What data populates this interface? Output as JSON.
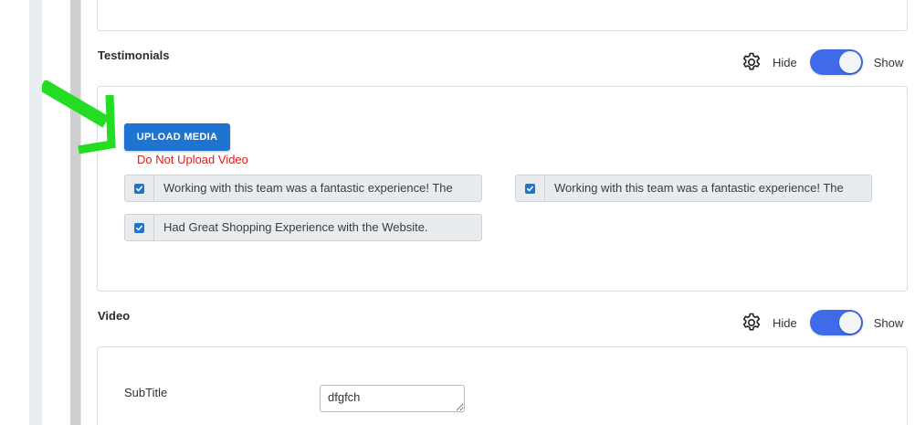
{
  "testimonials": {
    "title": "Testimonials",
    "controls": {
      "hide_label": "Hide",
      "show_label": "Show",
      "toggle_on": true
    },
    "upload_button_label": "UPLOAD MEDIA",
    "warning_text": "Do Not Upload Video",
    "items": [
      {
        "text": "Working with this team was a fantastic experience! The",
        "checked": true
      },
      {
        "text": "Working with this team was a fantastic experience! The",
        "checked": true
      },
      {
        "text": "Had Great Shopping Experience with the Website.",
        "checked": true
      }
    ]
  },
  "video": {
    "title": "Video",
    "controls": {
      "hide_label": "Hide",
      "show_label": "Show",
      "toggle_on": true
    },
    "subtitle_label": "SubTitle",
    "subtitle_value": "dfgfch"
  },
  "colors": {
    "primary": "#1f74d2",
    "toggle_on": "#3f6ae8",
    "warning": "#e01b1b",
    "annotation_arrow": "#22dd22"
  },
  "icons": [
    "gear-icon",
    "checkmark-icon",
    "arrow-annotation"
  ]
}
